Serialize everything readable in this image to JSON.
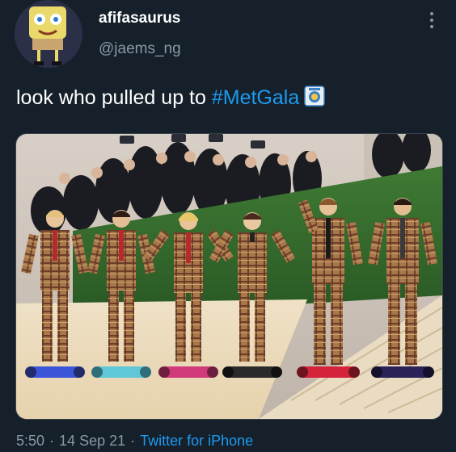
{
  "user": {
    "display_name": "afifasaurus",
    "handle": "@jaems_ng"
  },
  "tweet": {
    "text_prefix": "look who pulled up to ",
    "hashtag": "#MetGala",
    "emoji": "metgala-badge-icon"
  },
  "meta": {
    "time": "5:50",
    "sep1": "·",
    "date": "14 Sep 21",
    "sep2": "·",
    "source": "Twitter for iPhone"
  },
  "colors": {
    "background": "#15202b",
    "text": "#ffffff",
    "muted": "#8899a6",
    "accent": "#1d9bf0"
  }
}
